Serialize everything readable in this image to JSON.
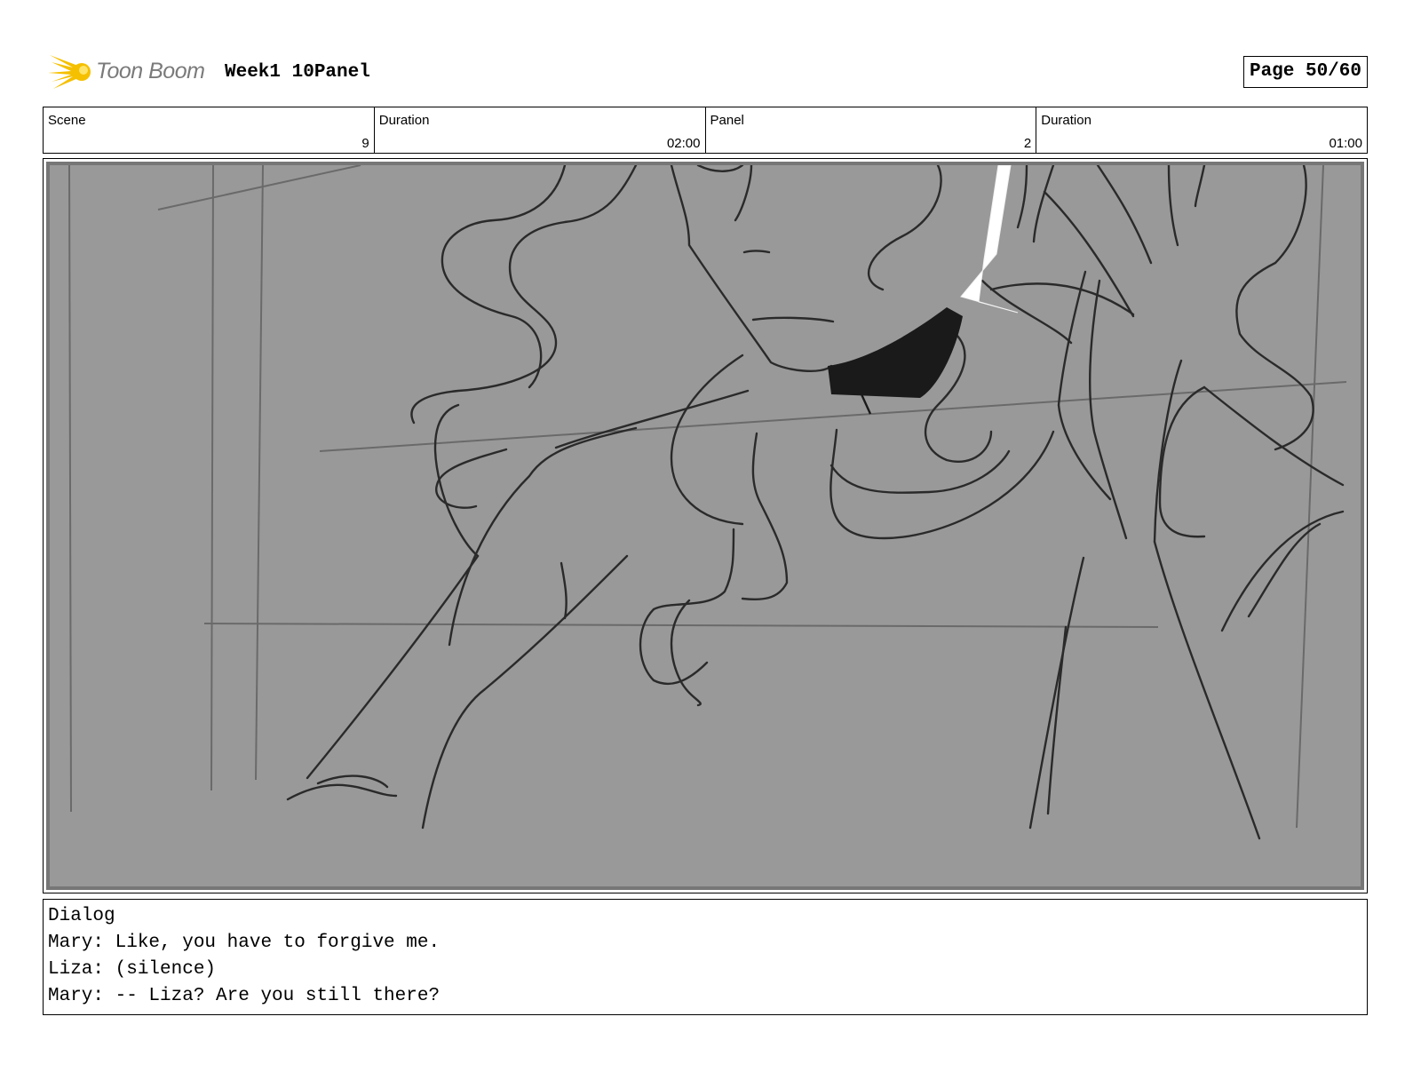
{
  "header": {
    "brand": "Toon Boom",
    "title": "Week1 10Panel",
    "page": "Page 50/60"
  },
  "info": {
    "scene_label": "Scene",
    "scene_value": "9",
    "scene_duration_label": "Duration",
    "scene_duration_value": "02:00",
    "panel_label": "Panel",
    "panel_value": "2",
    "panel_duration_label": "Duration",
    "panel_duration_value": "01:00"
  },
  "dialog": {
    "heading": "Dialog",
    "lines": [
      "Mary: Like, you have to forgive me.",
      "Liza: (silence)",
      "Mary: -- Liza? Are you still there?"
    ]
  },
  "colors": {
    "panel_background": "#999999",
    "logo_yellow": "#f5c000"
  }
}
